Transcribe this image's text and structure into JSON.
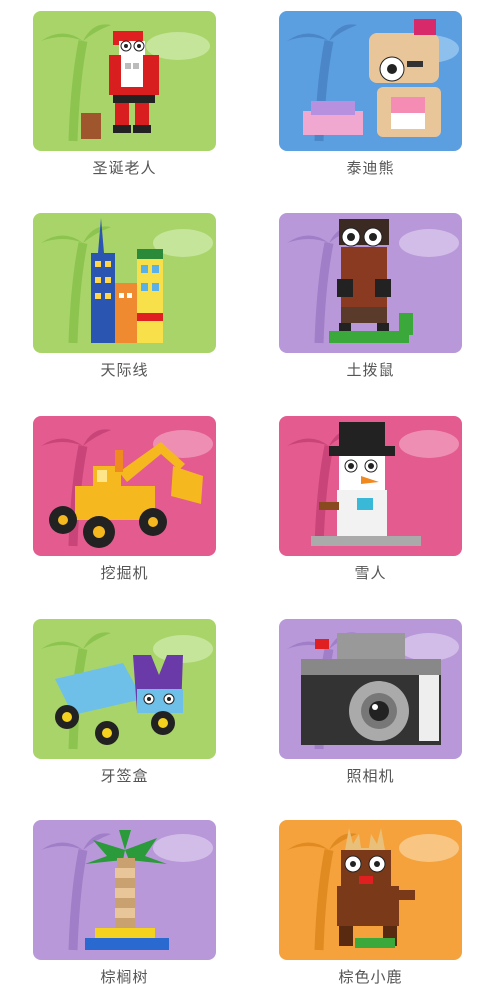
{
  "items": [
    {
      "label": "圣诞老人",
      "bg": "#a9d46a",
      "palm": "#8cc44f",
      "cloud": "#c5e59a",
      "icon": "santa-figure-icon"
    },
    {
      "label": "泰迪熊",
      "bg": "#5b9fe0",
      "palm": "#4a86c8",
      "cloud": "#8ec0ee",
      "icon": "teddy-bear-figure-icon"
    },
    {
      "label": "天际线",
      "bg": "#a9d46a",
      "palm": "#8cc44f",
      "cloud": "#c5e59a",
      "icon": "skyline-buildings-icon"
    },
    {
      "label": "土拨鼠",
      "bg": "#b898d8",
      "palm": "#a07ec8",
      "cloud": "#d2bde8",
      "icon": "groundhog-figure-icon"
    },
    {
      "label": "挖掘机",
      "bg": "#e35b8f",
      "palm": "#c94478",
      "cloud": "#ee8eb3",
      "icon": "excavator-icon"
    },
    {
      "label": "雪人",
      "bg": "#e35b8f",
      "palm": "#c94478",
      "cloud": "#ee8eb3",
      "icon": "snowman-figure-icon"
    },
    {
      "label": "牙签盒",
      "bg": "#a9d46a",
      "palm": "#8cc44f",
      "cloud": "#c5e59a",
      "icon": "toothpick-box-truck-icon"
    },
    {
      "label": "照相机",
      "bg": "#b898d8",
      "palm": "#a07ec8",
      "cloud": "#d2bde8",
      "icon": "camera-icon"
    },
    {
      "label": "棕榈树",
      "bg": "#b898d8",
      "palm": "#a07ec8",
      "cloud": "#d2bde8",
      "icon": "palm-tree-icon"
    },
    {
      "label": "棕色小鹿",
      "bg": "#f5a23c",
      "palm": "#e08a22",
      "cloud": "#f8c583",
      "icon": "brown-deer-figure-icon"
    }
  ]
}
